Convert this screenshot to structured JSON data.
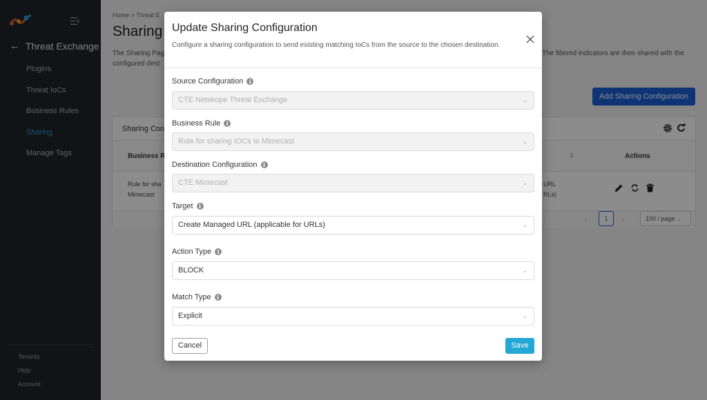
{
  "sidebar": {
    "app_section": "Threat Exchange",
    "items": [
      {
        "label": "Plugins"
      },
      {
        "label": "Threat IoCs"
      },
      {
        "label": "Business Rules"
      },
      {
        "label": "Sharing"
      },
      {
        "label": "Manage Tags"
      }
    ],
    "active_index": 3,
    "bottom_items": [
      {
        "label": "Tenants"
      },
      {
        "label": "Help"
      },
      {
        "label": "Account"
      }
    ]
  },
  "main": {
    "breadcrumb": "Home  >  Threat E",
    "title": "Sharing",
    "description_left": "The Sharing Pag",
    "description_left_2": "configured dest",
    "description_right": "The filtered indicators are then shared with the",
    "add_button": "Add Sharing Configuration",
    "panel_title": "Sharing Con",
    "table": {
      "col_business_rule": "Business Ru",
      "col_actions": "Actions",
      "row_rule_line1": "Rule for sha",
      "row_rule_line2": "Mimecast",
      "row_target_line1": "URL",
      "row_target_line2": "RLs)"
    },
    "pagination": {
      "current_page": "1",
      "page_size": "100 / page"
    }
  },
  "modal": {
    "title": "Update Sharing Configuration",
    "subtitle": "Configure a sharing configuration to send existing matching IoCs from the source to the chosen destination.",
    "fields": {
      "source": {
        "label": "Source Configuration",
        "value": "CTE Netskope Threat Exchange"
      },
      "business_rule": {
        "label": "Business Rule",
        "value": "Rule for sharing IOCs to Mimecast"
      },
      "destination": {
        "label": "Destination Configuration",
        "value": "CTE Mimecast"
      },
      "target": {
        "label": "Target",
        "value": "Create Managed URL (applicable for URLs)"
      },
      "action_type": {
        "label": "Action Type",
        "value": "BLOCK"
      },
      "match_type": {
        "label": "Match Type",
        "value": "Explicit"
      }
    },
    "cancel_label": "Cancel",
    "save_label": "Save"
  },
  "icons": {
    "logo": "netskope-logo-icon",
    "collapse": "menu-collapse-icon",
    "back": "arrow-left-icon",
    "info": "info-icon",
    "chevron": "chevron-down-icon",
    "close": "close-icon"
  },
  "colors": {
    "sidebar_bg": "#1f2329",
    "active_nav": "#2a9fd6",
    "primary": "#1a5fd6",
    "save": "#23a7d4"
  }
}
